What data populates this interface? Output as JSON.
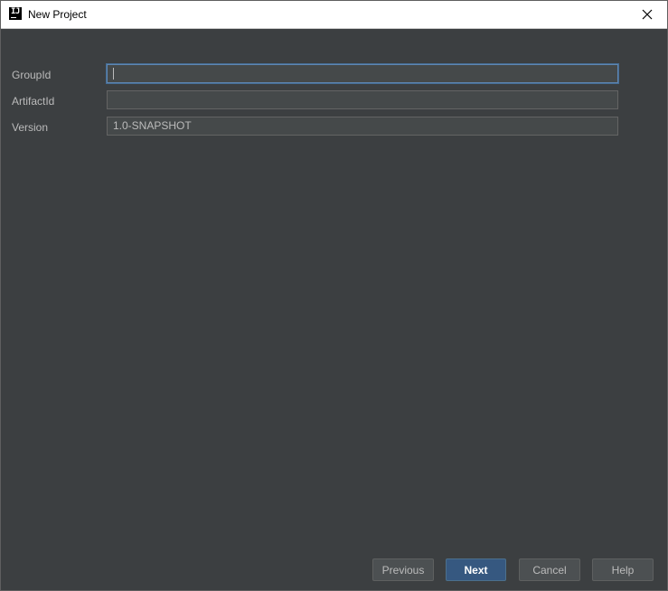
{
  "window": {
    "title": "New Project"
  },
  "form": {
    "fields": [
      {
        "label": "GroupId",
        "value": "",
        "focused": true
      },
      {
        "label": "ArtifactId",
        "value": ""
      },
      {
        "label": "Version",
        "value": "1.0-SNAPSHOT"
      }
    ]
  },
  "buttons": {
    "previous": "Previous",
    "next": "Next",
    "cancel": "Cancel",
    "help": "Help"
  },
  "icons": {
    "app": "intellij-idea-icon",
    "close": "close-icon"
  },
  "colors": {
    "background": "#3c3f41",
    "field_background": "#45494a",
    "focus_border": "#5e86b3",
    "default_button": "#365880",
    "text": "#bbbbbb"
  }
}
